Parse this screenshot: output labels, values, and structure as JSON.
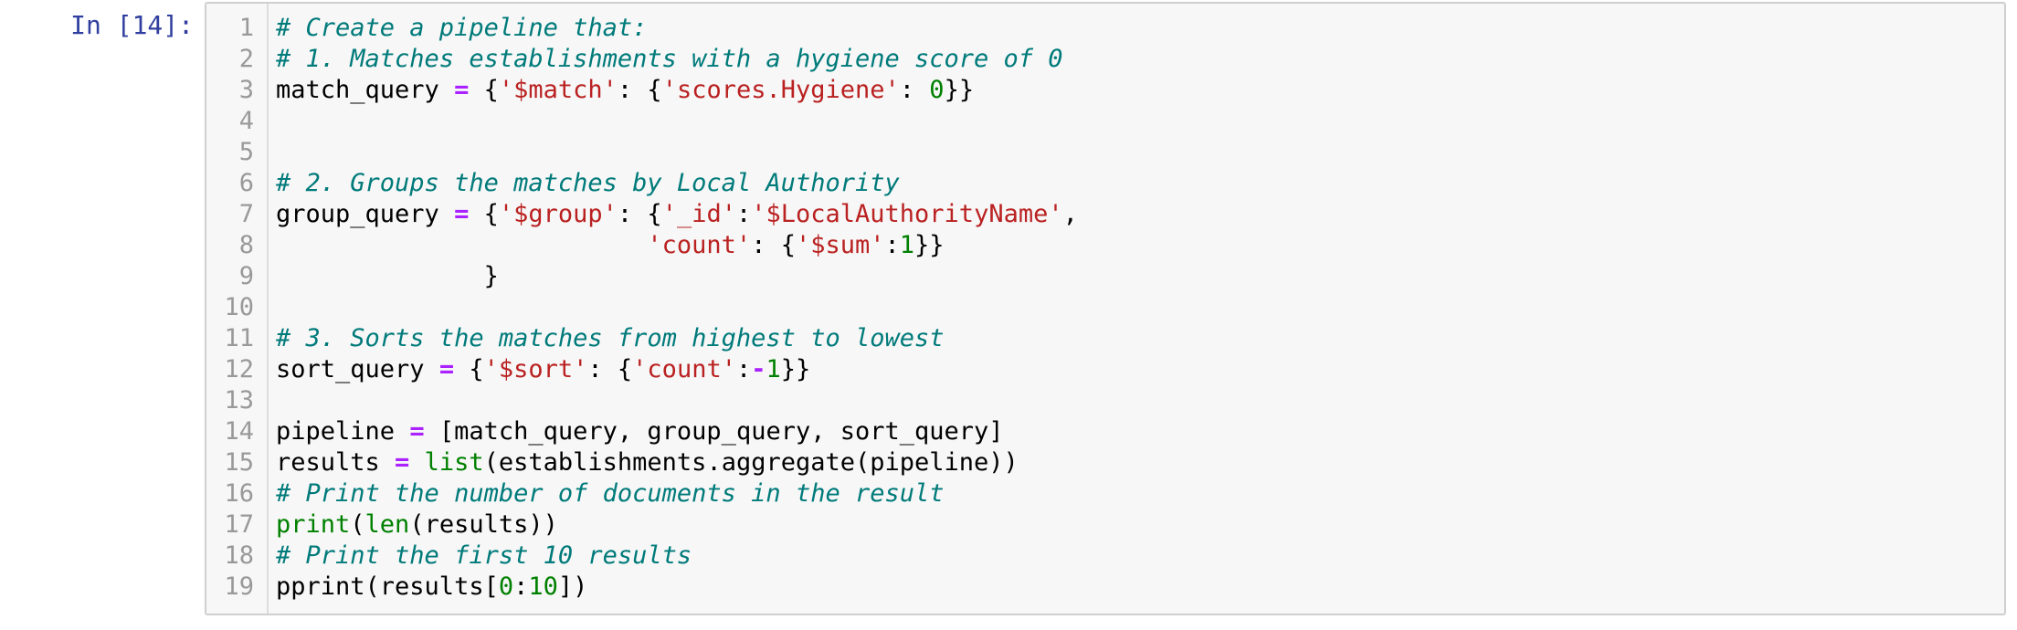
{
  "cell": {
    "prompt": "In [14]:",
    "line_numbers": [
      "1",
      "2",
      "3",
      "4",
      "5",
      "6",
      "7",
      "8",
      "9",
      "10",
      "11",
      "12",
      "13",
      "14",
      "15",
      "16",
      "17",
      "18",
      "19"
    ],
    "lines": [
      [
        {
          "t": "comment",
          "v": "# Create a pipeline that:"
        }
      ],
      [
        {
          "t": "comment",
          "v": "# 1. Matches establishments with a hygiene score of 0"
        }
      ],
      [
        {
          "t": "text",
          "v": "match_query "
        },
        {
          "t": "op",
          "v": "="
        },
        {
          "t": "text",
          "v": " {"
        },
        {
          "t": "string",
          "v": "'$match'"
        },
        {
          "t": "text",
          "v": ": {"
        },
        {
          "t": "string",
          "v": "'scores.Hygiene'"
        },
        {
          "t": "text",
          "v": ": "
        },
        {
          "t": "number",
          "v": "0"
        },
        {
          "t": "text",
          "v": "}}"
        }
      ],
      [],
      [],
      [
        {
          "t": "comment",
          "v": "# 2. Groups the matches by Local Authority"
        }
      ],
      [
        {
          "t": "text",
          "v": "group_query "
        },
        {
          "t": "op",
          "v": "="
        },
        {
          "t": "text",
          "v": " {"
        },
        {
          "t": "string",
          "v": "'$group'"
        },
        {
          "t": "text",
          "v": ": {"
        },
        {
          "t": "string",
          "v": "'_id'"
        },
        {
          "t": "text",
          "v": ":"
        },
        {
          "t": "string",
          "v": "'$LocalAuthorityName'"
        },
        {
          "t": "text",
          "v": ","
        }
      ],
      [
        {
          "t": "text",
          "v": "                         "
        },
        {
          "t": "string",
          "v": "'count'"
        },
        {
          "t": "text",
          "v": ": {"
        },
        {
          "t": "string",
          "v": "'$sum'"
        },
        {
          "t": "text",
          "v": ":"
        },
        {
          "t": "number",
          "v": "1"
        },
        {
          "t": "text",
          "v": "}}"
        }
      ],
      [
        {
          "t": "text",
          "v": "              }"
        }
      ],
      [],
      [
        {
          "t": "comment",
          "v": "# 3. Sorts the matches from highest to lowest"
        }
      ],
      [
        {
          "t": "text",
          "v": "sort_query "
        },
        {
          "t": "op",
          "v": "="
        },
        {
          "t": "text",
          "v": " {"
        },
        {
          "t": "string",
          "v": "'$sort'"
        },
        {
          "t": "text",
          "v": ": {"
        },
        {
          "t": "string",
          "v": "'count'"
        },
        {
          "t": "text",
          "v": ":"
        },
        {
          "t": "op",
          "v": "-"
        },
        {
          "t": "number",
          "v": "1"
        },
        {
          "t": "text",
          "v": "}}"
        }
      ],
      [],
      [
        {
          "t": "text",
          "v": "pipeline "
        },
        {
          "t": "op",
          "v": "="
        },
        {
          "t": "text",
          "v": " [match_query, group_query, sort_query]"
        }
      ],
      [
        {
          "t": "text",
          "v": "results "
        },
        {
          "t": "op",
          "v": "="
        },
        {
          "t": "text",
          "v": " "
        },
        {
          "t": "builtin",
          "v": "list"
        },
        {
          "t": "text",
          "v": "(establishments.aggregate(pipeline))"
        }
      ],
      [
        {
          "t": "comment",
          "v": "# Print the number of documents in the result"
        }
      ],
      [
        {
          "t": "builtin",
          "v": "print"
        },
        {
          "t": "text",
          "v": "("
        },
        {
          "t": "builtin",
          "v": "len"
        },
        {
          "t": "text",
          "v": "(results))"
        }
      ],
      [
        {
          "t": "comment",
          "v": "# Print the first 10 results"
        }
      ],
      [
        {
          "t": "text",
          "v": "pprint(results["
        },
        {
          "t": "number",
          "v": "0"
        },
        {
          "t": "text",
          "v": ":"
        },
        {
          "t": "number",
          "v": "10"
        },
        {
          "t": "text",
          "v": "])"
        }
      ]
    ]
  }
}
